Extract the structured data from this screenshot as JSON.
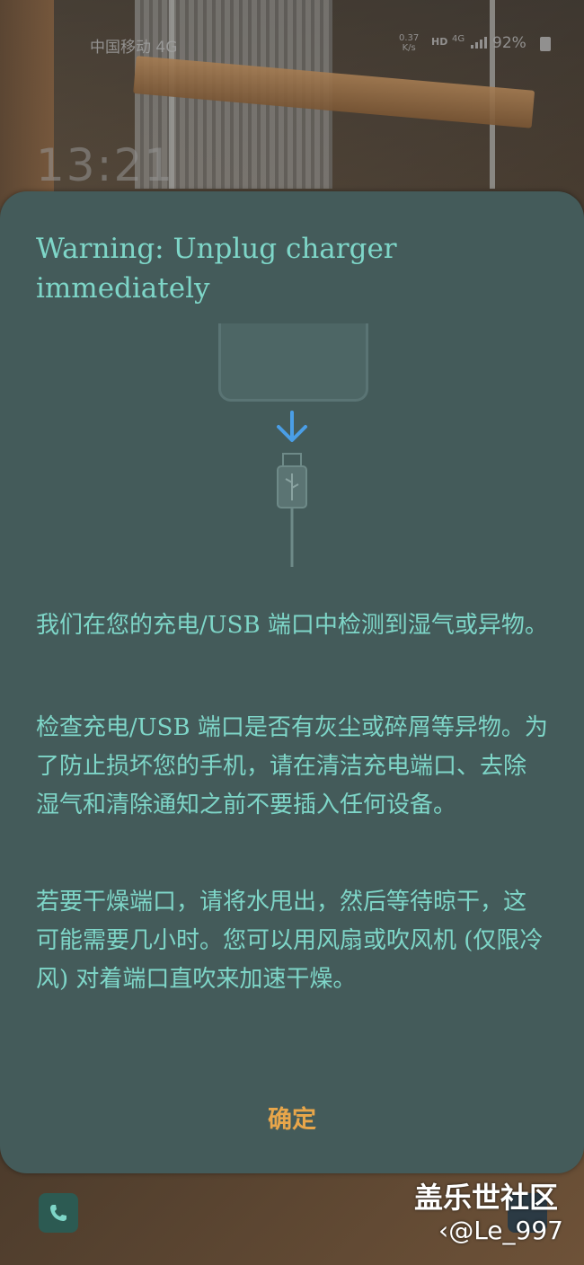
{
  "status_bar": {
    "carrier": "中国移动 4G",
    "speed_value": "0.37",
    "speed_unit": "K/s",
    "hd": "HD",
    "network": "4G",
    "battery": "92%"
  },
  "lock_screen": {
    "time": "13:21"
  },
  "dialog": {
    "title": "Warning: Unplug charger immediately",
    "paragraph1": "我们在您的充电/USB 端口中检测到湿气或异物。",
    "paragraph2": "检查充电/USB 端口是否有灰尘或碎屑等异物。为了防止损坏您的手机，请在清洁充电端口、去除湿气和清除通知之前不要插入任何设备。",
    "paragraph3": "若要干燥端口，请将水甩出，然后等待晾干，这可能需要几小时。您可以用风扇或吹风机 (仅限冷风) 对着端口直吹来加速干燥。",
    "ok_label": "确定"
  },
  "watermark": {
    "site": "盖乐世社区",
    "user": "@Le_997"
  },
  "colors": {
    "dialog_bg": "#445b5a",
    "text": "#7ed6c8",
    "button": "#e8a64a",
    "arrow": "#4a9ee6"
  }
}
